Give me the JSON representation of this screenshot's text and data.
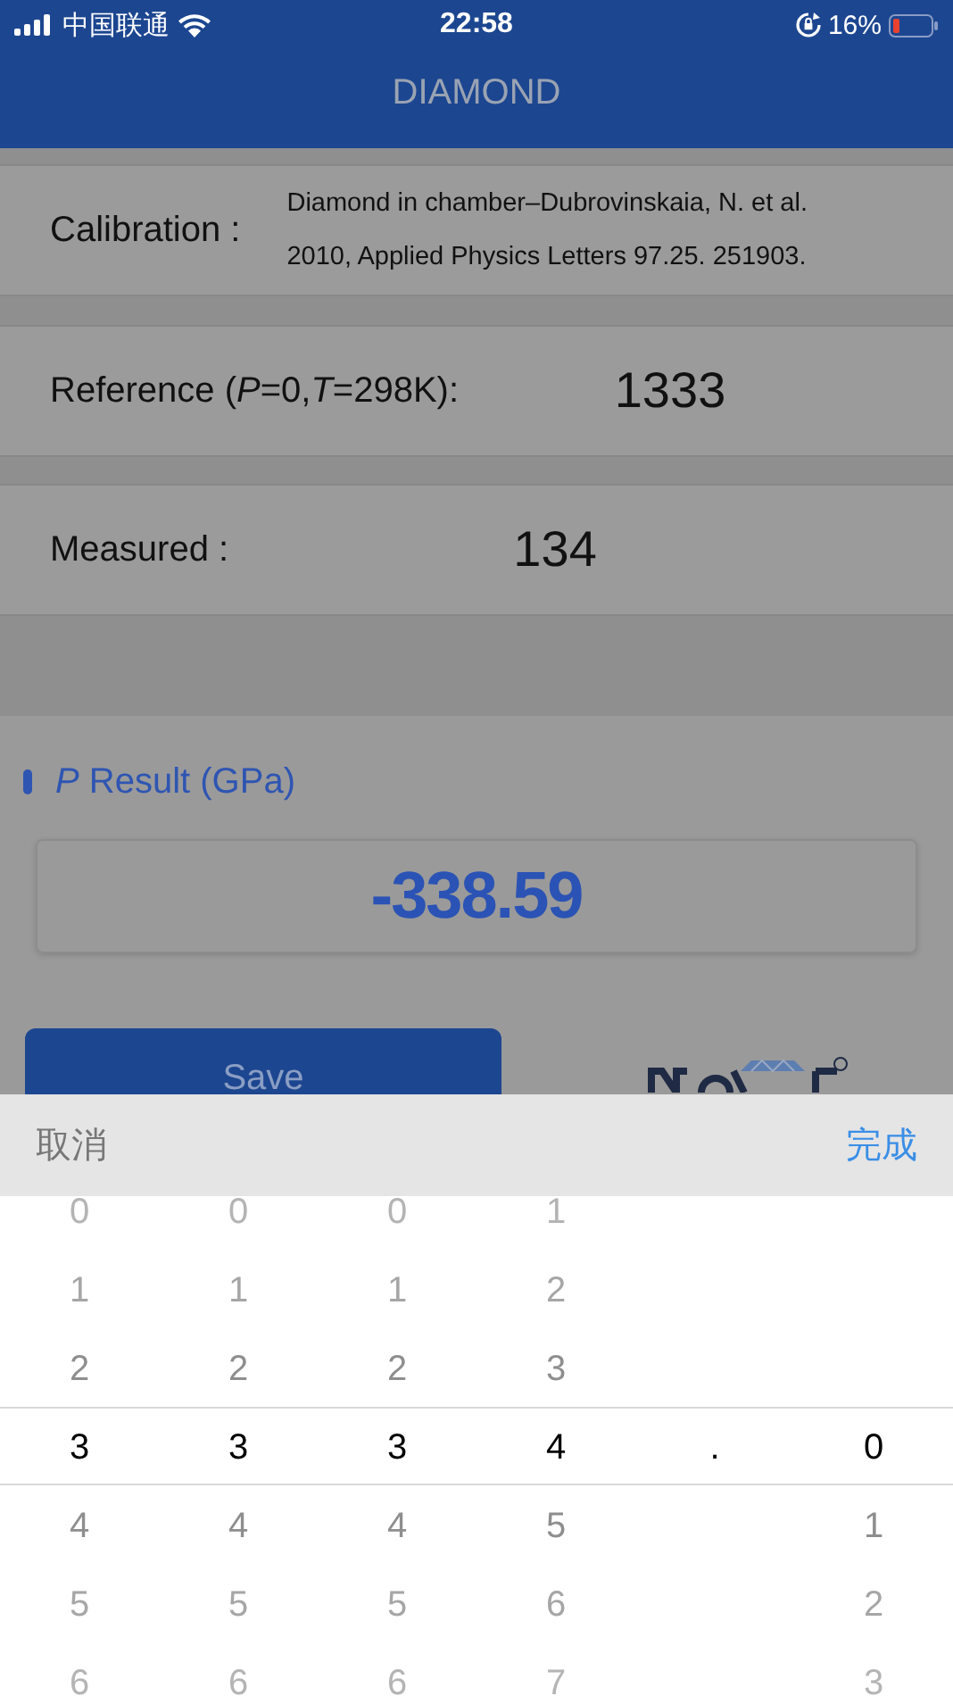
{
  "status_bar": {
    "carrier": "中国联通",
    "time": "22:58",
    "battery": "16%"
  },
  "nav": {
    "title": "DIAMOND"
  },
  "fields": [
    {
      "kind": "note",
      "label": "Calibration :",
      "value": "Diamond in chamber–Dubrovinskaia, N. et al. 2010, Applied Physics Letters 97.25. 251903."
    },
    {
      "kind": "number",
      "label": "Reference (*P*=0,*T*=298K):",
      "value": "1333"
    },
    {
      "kind": "number",
      "label": "Measured :",
      "value": "134"
    }
  ],
  "result": {
    "label": "*P* Result (GPa)",
    "value": "-338.59"
  },
  "save_button": "Save",
  "picker": {
    "cancel": "取消",
    "done": "完成",
    "columns": [
      {
        "items": [
          {
            "label": "0",
            "selected": false
          },
          {
            "label": "1",
            "selected": false
          },
          {
            "label": "2",
            "selected": false
          },
          {
            "label": "3",
            "selected": true
          },
          {
            "label": "4",
            "selected": false
          },
          {
            "label": "5",
            "selected": false
          },
          {
            "label": "6",
            "selected": false
          }
        ]
      },
      {
        "items": [
          {
            "label": "0",
            "selected": false
          },
          {
            "label": "1",
            "selected": false
          },
          {
            "label": "2",
            "selected": false
          },
          {
            "label": "3",
            "selected": true
          },
          {
            "label": "4",
            "selected": false
          },
          {
            "label": "5",
            "selected": false
          },
          {
            "label": "6",
            "selected": false
          }
        ]
      },
      {
        "items": [
          {
            "label": "0",
            "selected": false
          },
          {
            "label": "1",
            "selected": false
          },
          {
            "label": "2",
            "selected": false
          },
          {
            "label": "3",
            "selected": true
          },
          {
            "label": "4",
            "selected": false
          },
          {
            "label": "5",
            "selected": false
          },
          {
            "label": "6",
            "selected": false
          }
        ]
      },
      {
        "items": [
          {
            "label": "1",
            "selected": false
          },
          {
            "label": "2",
            "selected": false
          },
          {
            "label": "3",
            "selected": false
          },
          {
            "label": "4",
            "selected": true
          },
          {
            "label": "5",
            "selected": false
          },
          {
            "label": "6",
            "selected": false
          },
          {
            "label": "7",
            "selected": false
          }
        ]
      },
      {
        "items": [
          {
            "label": ".",
            "selected": true
          }
        ]
      },
      {
        "items": [
          {
            "label": "0",
            "selected": true
          },
          {
            "label": "1",
            "selected": false
          },
          {
            "label": "2",
            "selected": false
          },
          {
            "label": "3",
            "selected": false
          }
        ]
      }
    ]
  }
}
